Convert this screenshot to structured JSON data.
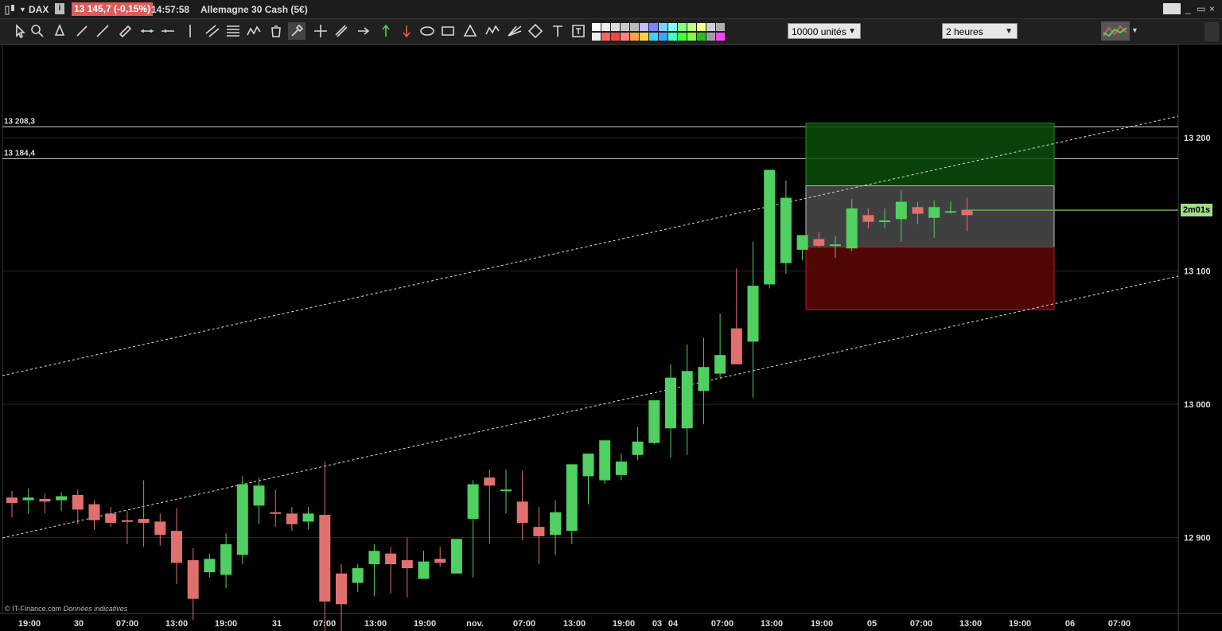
{
  "title_bar": {
    "symbol": "DAX",
    "info_icon": "info-icon",
    "price_badge": "13 145,7 (-0,15%)",
    "price_badge_color": "#e05a5a",
    "time": "14:57:58",
    "instrument": "Allemagne 30 Cash (5€)",
    "window_buttons": [
      "_",
      "▭",
      "×"
    ]
  },
  "toolbar": {
    "quantity": "10000 unités",
    "timeframe": "2 heures",
    "tools": [
      "cursor-icon",
      "zoom-icon",
      "alert-icon",
      "line-icon",
      "trendline-icon",
      "ruler-icon",
      "hline-icon",
      "hray-icon",
      "vline-icon",
      "channel-icon",
      "fibonacci-icon",
      "wave-icon",
      "trash-icon",
      "settings-icon",
      "crosshair-icon",
      "parallel-icon",
      "arrow-right-icon",
      "arrow-up-icon",
      "arrow-down-icon",
      "ellipse-icon",
      "rectangle-icon",
      "triangle-icon",
      "pattern-icon",
      "gann-icon",
      "diamond-icon",
      "text-icon",
      "textbox-icon"
    ]
  },
  "colors": {
    "up": "#4fd060",
    "down": "#e07070",
    "background": "#000000",
    "grid": "#262626",
    "target_zone": "#0b4d0b",
    "stop_zone": "#5a0707",
    "entry_zone": "#555555"
  },
  "timer": "2m01s",
  "credit": "© IT-Finance.com",
  "credit_note": "Données indicatives",
  "chart_data": {
    "type": "candlestick",
    "timeframe": "2 heures",
    "ylim": [
      12840,
      13280
    ],
    "yticks": [
      "13 200",
      "13 100",
      "13 000",
      "12 900"
    ],
    "ytick_values": [
      13200,
      13100,
      13000,
      12900
    ],
    "xtick_labels": [
      "19:00",
      "30",
      "07:00",
      "13:00",
      "19:00",
      "31",
      "07:00",
      "13:00",
      "19:00",
      "nov.",
      "07:00",
      "13:00",
      "19:00",
      "03",
      "04",
      "07:00",
      "13:00",
      "19:00",
      "05",
      "07:00",
      "13:00",
      "19:00",
      "06",
      "07:00"
    ],
    "horizontal_levels": [
      {
        "label": "13 208,3",
        "value": 13208.3
      },
      {
        "label": "13 184,4",
        "value": 13184.4
      }
    ],
    "current_price": 13145.7,
    "candles": [
      [
        12930,
        12935,
        12915,
        12926
      ],
      [
        12928,
        12937,
        12918,
        12930
      ],
      [
        12929,
        12933,
        12918,
        12927
      ],
      [
        12928,
        12934,
        12920,
        12931
      ],
      [
        12932,
        12936,
        12910,
        12921
      ],
      [
        12925,
        12928,
        12906,
        12913
      ],
      [
        12918,
        12923,
        12908,
        12911
      ],
      [
        12913,
        12920,
        12895,
        12912
      ],
      [
        12914,
        12943,
        12893,
        12911
      ],
      [
        12912,
        12918,
        12894,
        12902
      ],
      [
        12905,
        12922,
        12865,
        12881
      ],
      [
        12883,
        12892,
        12838,
        12854
      ],
      [
        12874,
        12888,
        12870,
        12884
      ],
      [
        12872,
        12903,
        12862,
        12895
      ],
      [
        12887,
        12946,
        12880,
        12940
      ],
      [
        12924,
        12945,
        12910,
        12939
      ],
      [
        12919,
        12936,
        12908,
        12918
      ],
      [
        12918,
        12923,
        12905,
        12910
      ],
      [
        12912,
        12923,
        12906,
        12918
      ],
      [
        12917,
        12957,
        12815,
        12852
      ],
      [
        12873,
        12880,
        12813,
        12850
      ],
      [
        12866,
        12880,
        12859,
        12877
      ],
      [
        12880,
        12895,
        12856,
        12890
      ],
      [
        12888,
        12893,
        12858,
        12880
      ],
      [
        12883,
        12900,
        12855,
        12877
      ],
      [
        12869,
        12890,
        12880,
        12882
      ],
      [
        12884,
        12893,
        12878,
        12881
      ],
      [
        12873,
        12890,
        12878,
        12899
      ],
      [
        12914,
        12943,
        12870,
        12940
      ],
      [
        12945,
        12951,
        12895,
        12939
      ],
      [
        12936,
        12951,
        12918,
        12936
      ],
      [
        12927,
        12950,
        12898,
        12911
      ],
      [
        12908,
        12923,
        12880,
        12901
      ],
      [
        12902,
        12928,
        12887,
        12919
      ],
      [
        12905,
        12940,
        12895,
        12955
      ],
      [
        12946,
        12958,
        12925,
        12963
      ],
      [
        12943,
        12962,
        12940,
        12973
      ],
      [
        12947,
        12963,
        12943,
        12957
      ],
      [
        12962,
        12983,
        12958,
        12972
      ],
      [
        12971,
        13000,
        12970,
        13003
      ],
      [
        12982,
        13030,
        12960,
        13020
      ],
      [
        12982,
        13045,
        12962,
        13025
      ],
      [
        13010,
        13050,
        12985,
        13028
      ],
      [
        13023,
        13068,
        13020,
        13037
      ],
      [
        13057,
        13102,
        13052,
        13030
      ],
      [
        13047,
        13122,
        13005,
        13089
      ],
      [
        13090,
        13162,
        13087,
        13176
      ],
      [
        13106,
        13168,
        13098,
        13155
      ],
      [
        13116,
        13124,
        13108,
        13127
      ],
      [
        13124,
        13129,
        13118,
        13119
      ],
      [
        13120,
        13126,
        13110,
        13120
      ],
      [
        13117,
        13154,
        13115,
        13147
      ],
      [
        13142,
        13147,
        13132,
        13137
      ],
      [
        13137,
        13147,
        13132,
        13138
      ],
      [
        13139,
        13161,
        13122,
        13152
      ],
      [
        13148,
        13152,
        13135,
        13143
      ],
      [
        13140,
        13153,
        13125,
        13148
      ],
      [
        13145,
        13152,
        13143,
        13145
      ],
      [
        13146,
        13155,
        13130,
        13142
      ]
    ],
    "trade_box": {
      "target": 13211,
      "entry_top": 13164,
      "entry_bottom": 13118,
      "stop": 13071
    },
    "channel_lines": [
      {
        "from": [
          12995,
          13213
        ]
      },
      {
        "from": [
          12819,
          13093
        ]
      }
    ]
  }
}
